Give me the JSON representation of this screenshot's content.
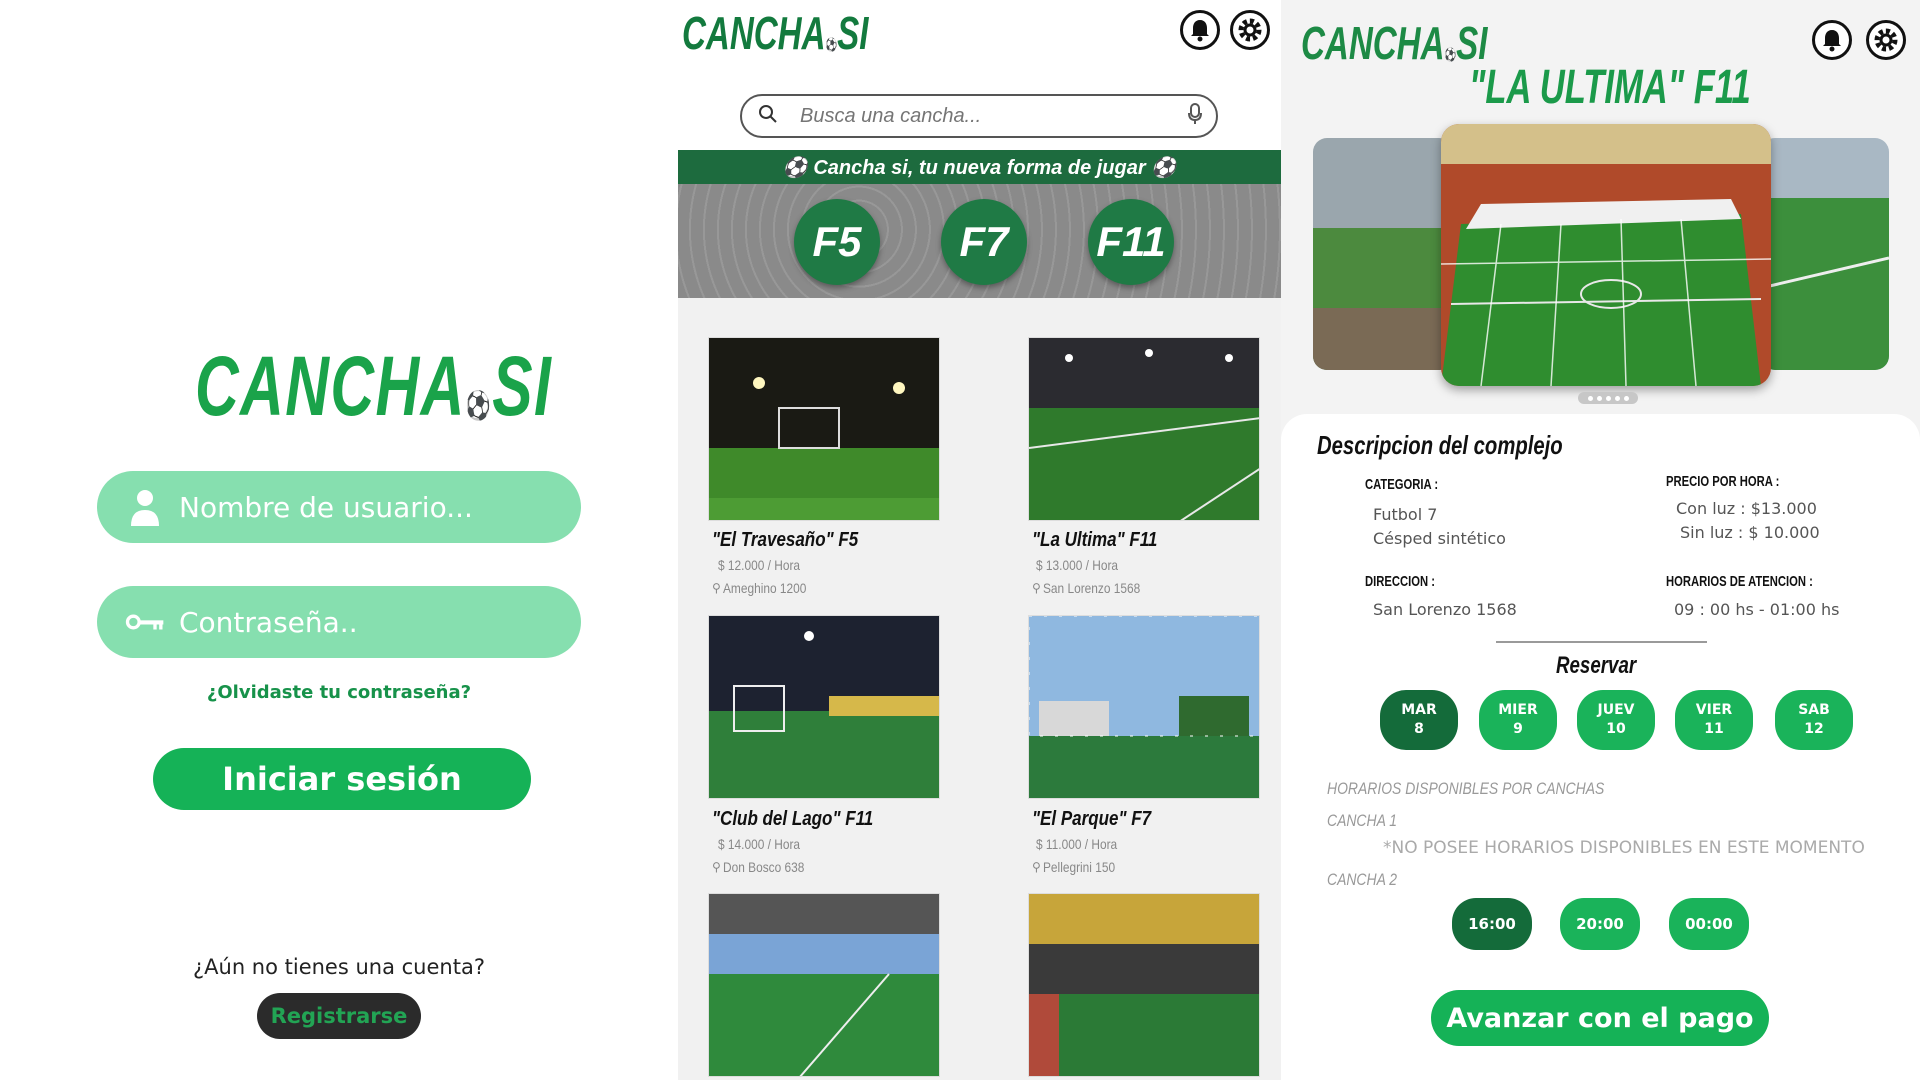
{
  "login": {
    "logo": "CANCHA",
    "logo_suffix": "SI",
    "username_placeholder": "Nombre de usuario...",
    "password_placeholder": "Contraseña..",
    "forgot_label": "¿Olvidaste tu contraseña?",
    "login_button": "Iniciar sesión",
    "no_account_text": "¿Aún no tienes una cuenta?",
    "register_button": "Registrarse",
    "accent": "#15b257",
    "input_bg": "#86dfaf"
  },
  "list": {
    "logo": "CANCHA",
    "logo_suffix": "SI",
    "search_placeholder": "Busca una cancha...",
    "banner": "⚽ Cancha si, tu nueva forma de jugar ⚽",
    "formats": [
      "F5",
      "F7",
      "F11"
    ],
    "cards": [
      {
        "title": "\"El Travesaño\" F5",
        "price": "$ 12.000 / Hora",
        "address": "Ameghino 1200"
      },
      {
        "title": "\"La Ultima\" F11",
        "price": "$ 13.000 / Hora",
        "address": "San Lorenzo 1568"
      },
      {
        "title": "\"Club del Lago\" F11",
        "price": "$ 14.000 / Hora",
        "address": "Don Bosco 638"
      },
      {
        "title": "\"El Parque\" F7",
        "price": "$ 11.000 / Hora",
        "address": "Pellegrini 150"
      }
    ],
    "header_dark": "#1d6b3e"
  },
  "detail": {
    "logo": "CANCHA",
    "logo_suffix": "SI",
    "title": "\"LA ULTIMA\" F11",
    "description_heading": "Descripcion del complejo",
    "category_label": "CATEGORIA :",
    "category_values": [
      "Futbol 7",
      "Césped sintético"
    ],
    "price_label": "PRECIO POR HORA :",
    "price_values": [
      "Con luz :  $13.000",
      "Sin luz : $ 10.000"
    ],
    "address_label": "DIRECCION :",
    "address_value": "San Lorenzo 1568",
    "hours_label": "HORARIOS DE ATENCION :",
    "hours_value": "09 : 00 hs - 01:00 hs",
    "reserve_heading": "Reservar",
    "days": [
      {
        "name": "MAR",
        "num": "8",
        "selected": true
      },
      {
        "name": "MIER",
        "num": "9",
        "selected": false
      },
      {
        "name": "JUEV",
        "num": "10",
        "selected": false
      },
      {
        "name": "VIER",
        "num": "11",
        "selected": false
      },
      {
        "name": "SAB",
        "num": "12",
        "selected": false
      }
    ],
    "available_heading": "HORARIOS DISPONIBLES POR CANCHAS",
    "court1_label": "CANCHA  1",
    "court1_note": "*NO POSEE HORARIOS DISPONIBLES EN ESTE MOMENTO",
    "court2_label": "CANCHA  2",
    "slots": [
      {
        "time": "16:00",
        "selected": true
      },
      {
        "time": "20:00",
        "selected": false
      },
      {
        "time": "00:00",
        "selected": false
      }
    ],
    "pay_button": "Avanzar con el pago",
    "selected_color": "#146b3a",
    "unselected_color": "#1ab35a"
  }
}
